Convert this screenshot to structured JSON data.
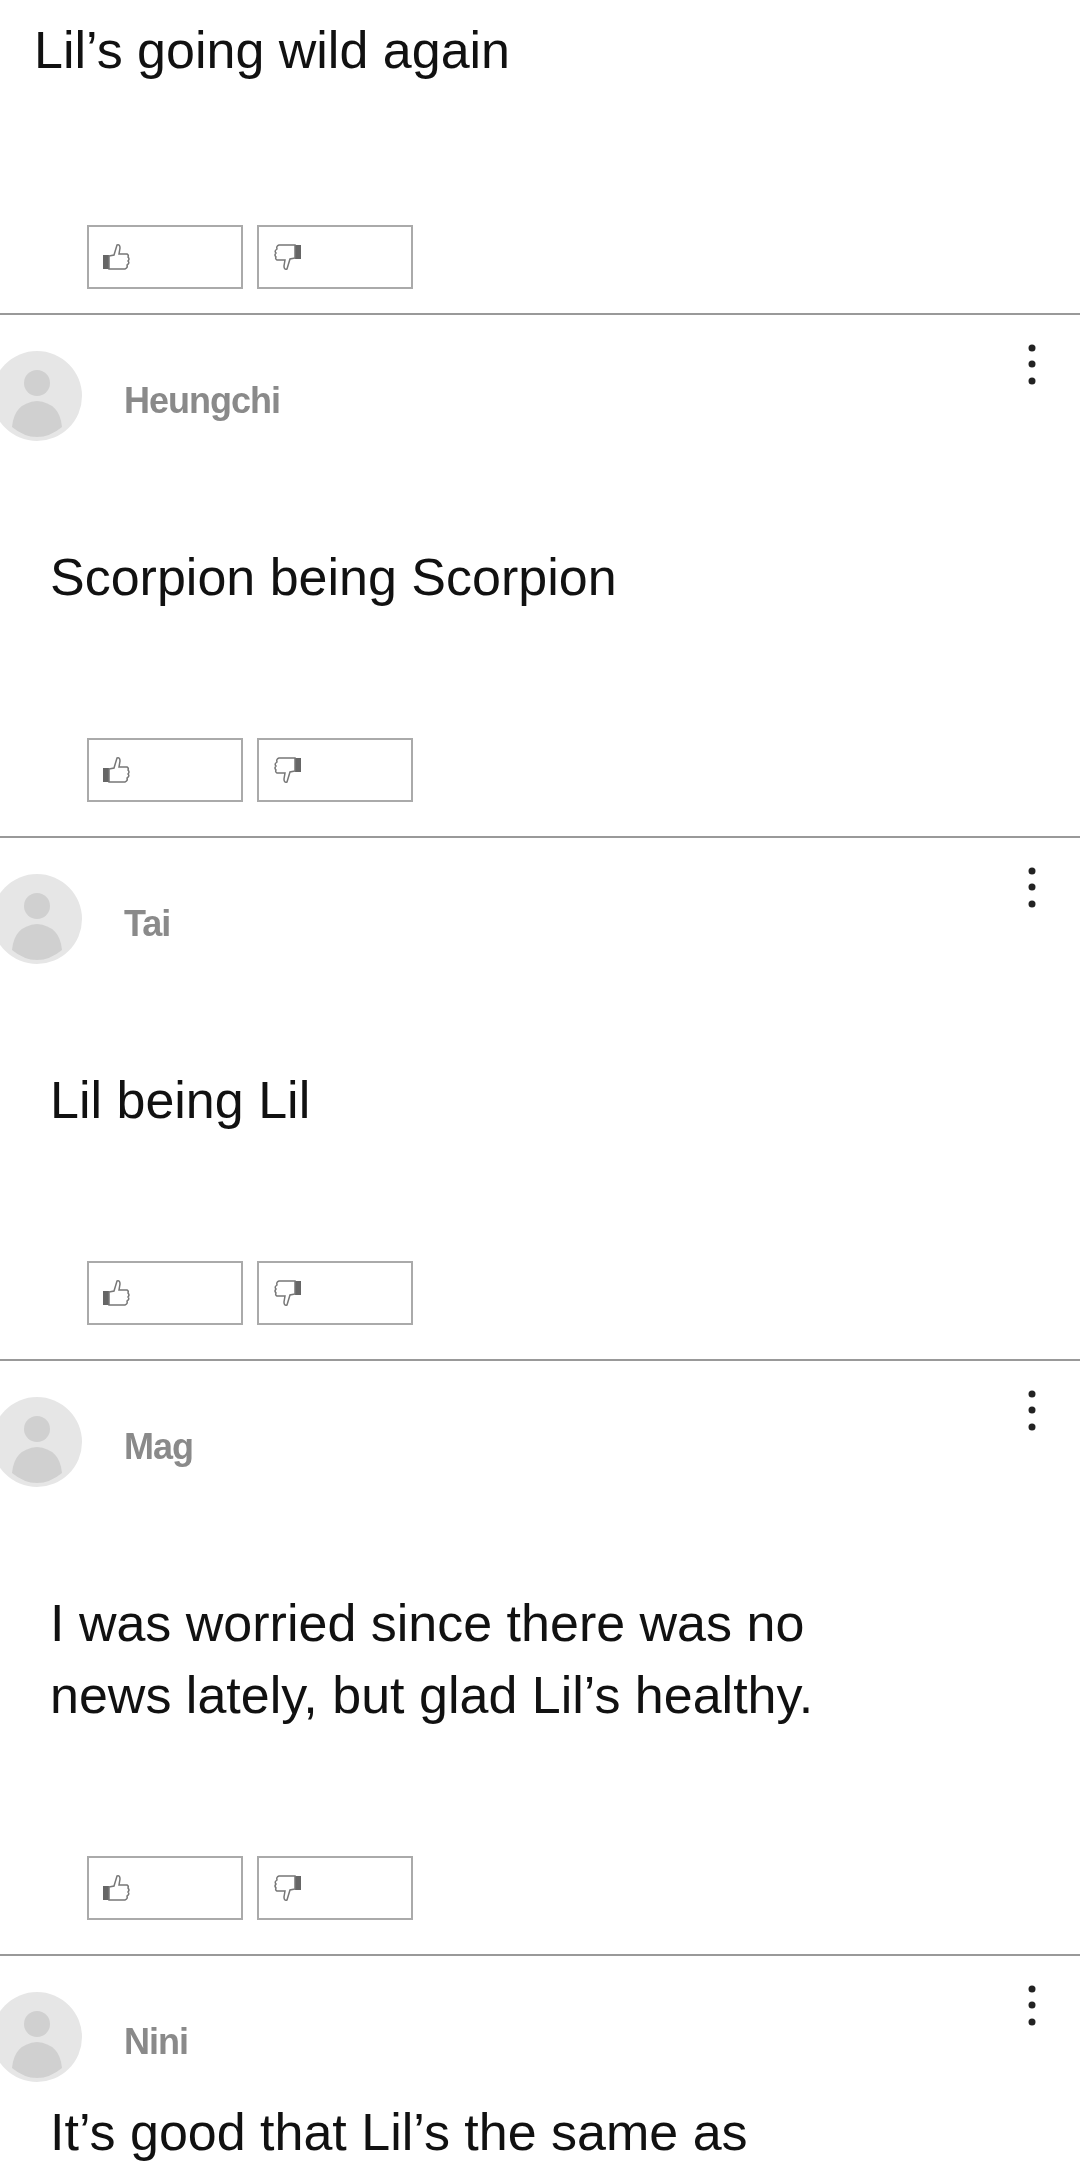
{
  "partial_comment": {
    "text": "Lil’s going wild again"
  },
  "comments": [
    {
      "author": "Heungchi",
      "text": "Scorpion being Scorpion"
    },
    {
      "author": "Tai",
      "text": "Lil being Lil"
    },
    {
      "author": "Mag",
      "text": "I was worried since there was no news lately, but glad Lil’s healthy."
    },
    {
      "author": "Nini",
      "text": "It’s good that Lil’s the same as"
    }
  ]
}
